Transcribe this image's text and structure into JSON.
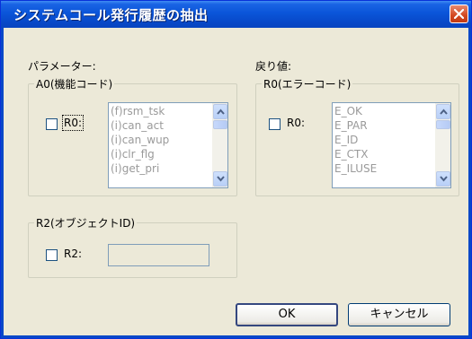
{
  "window": {
    "title": "システムコール発行履歴の抽出"
  },
  "params_label": "パラメーター:",
  "return_label": "戻り値:",
  "a0_group": {
    "legend": "A0(機能コード)",
    "checkbox_label": "R0:",
    "checked": false,
    "list_items": [
      "(f)rsm_tsk",
      "(i)can_act",
      "(i)can_wup",
      "(i)clr_flg",
      "(i)get_pri"
    ]
  },
  "r0_group": {
    "legend": "R0(エラーコード)",
    "checkbox_label": "R0:",
    "checked": false,
    "list_items": [
      "E_OK",
      "E_PAR",
      "E_ID",
      "E_CTX",
      "E_ILUSE"
    ]
  },
  "r2_group": {
    "legend": "R2(オブジェクトID)",
    "checkbox_label": "R2:",
    "checked": false,
    "value": ""
  },
  "buttons": {
    "ok": "OK",
    "cancel": "キャンセル"
  }
}
